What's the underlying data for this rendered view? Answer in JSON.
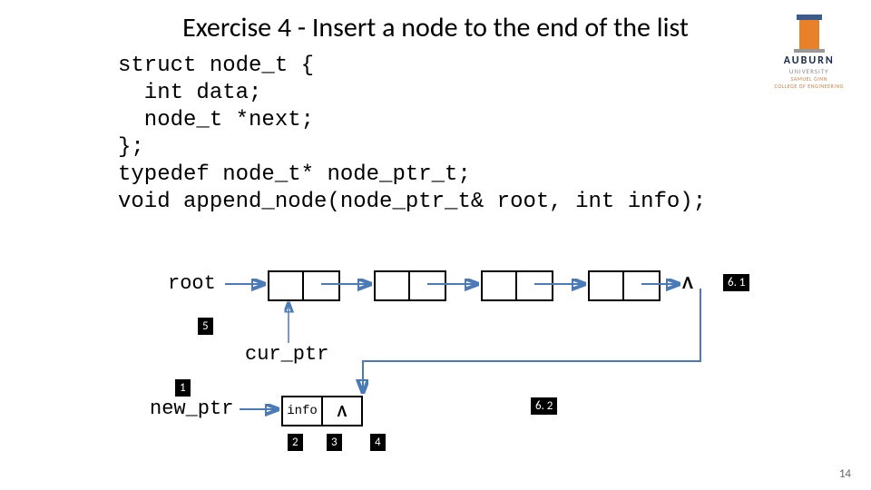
{
  "title": "Exercise 4 - Insert a node to the end of the list",
  "logo": {
    "name": "AUBURN",
    "sub1": "UNIVERSITY",
    "sub2": "SAMUEL GINN",
    "sub3": "COLLEGE OF ENGINEERING"
  },
  "code": "struct node_t {\n  int data;\n  node_t *next;\n};\ntypedef node_t* node_ptr_t;\nvoid append_node(node_ptr_t& root, int info);",
  "labels": {
    "root": "root",
    "cur_ptr": "cur_ptr",
    "new_ptr": "new_ptr",
    "info": "info"
  },
  "null_symbol": "Λ",
  "tags": {
    "t5": "5",
    "t1": "1",
    "t2": "2",
    "t3": "3",
    "t4": "4",
    "t61": "6. 1",
    "t62": "6. 2"
  },
  "page_number": "14",
  "chart_data": {
    "type": "diagram",
    "description": "Linked list with root pointer to 4 nodes, last node's next was null, being linked to new node (info, null). cur_ptr traverses list.",
    "list_nodes": 4,
    "new_node_fields": [
      "info",
      "Λ"
    ],
    "original_last_next": "Λ",
    "pointers": [
      "root",
      "cur_ptr",
      "new_ptr"
    ],
    "step_tags": [
      "5",
      "1",
      "2",
      "3",
      "4",
      "6. 1",
      "6. 2"
    ]
  }
}
